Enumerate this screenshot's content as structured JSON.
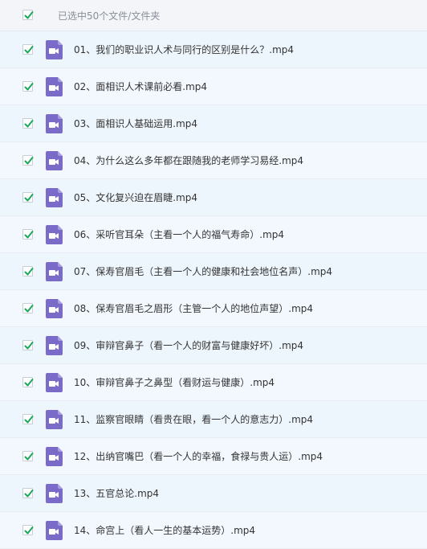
{
  "header": {
    "selection_text": "已选中50个文件/文件夹",
    "all_checked": true
  },
  "files": [
    {
      "name": "01、我们的职业识人术与同行的区别是什么？.mp4",
      "checked": true,
      "icon": "video-file-icon"
    },
    {
      "name": "02、面相识人术课前必看.mp4",
      "checked": true,
      "icon": "video-file-icon"
    },
    {
      "name": "03、面相识人基础运用.mp4",
      "checked": true,
      "icon": "video-file-icon"
    },
    {
      "name": "04、为什么这么多年都在跟随我的老师学习易经.mp4",
      "checked": true,
      "icon": "video-file-icon"
    },
    {
      "name": "05、文化复兴迫在眉睫.mp4",
      "checked": true,
      "icon": "video-file-icon"
    },
    {
      "name": "06、采听官耳朵（主看一个人的福气寿命）.mp4",
      "checked": true,
      "icon": "video-file-icon"
    },
    {
      "name": "07、保寿官眉毛（主看一个人的健康和社会地位名声）.mp4",
      "checked": true,
      "icon": "video-file-icon"
    },
    {
      "name": "08、保寿官眉毛之眉形（主管一个人的地位声望）.mp4",
      "checked": true,
      "icon": "video-file-icon"
    },
    {
      "name": "09、审辩官鼻子（看一个人的财富与健康好坏）.mp4",
      "checked": true,
      "icon": "video-file-icon"
    },
    {
      "name": "10、审辩官鼻子之鼻型（看财运与健康）.mp4",
      "checked": true,
      "icon": "video-file-icon"
    },
    {
      "name": "11、监察官眼睛（看贵在眼，看一个人的意志力）.mp4",
      "checked": true,
      "icon": "video-file-icon"
    },
    {
      "name": "12、出纳官嘴巴（看一个人的幸福，食禄与贵人运）.mp4",
      "checked": true,
      "icon": "video-file-icon"
    },
    {
      "name": "13、五官总论.mp4",
      "checked": true,
      "icon": "video-file-icon"
    },
    {
      "name": "14、命宫上（看人一生的基本运势）.mp4",
      "checked": true,
      "icon": "video-file-icon"
    }
  ],
  "colors": {
    "check": "#1aa85a",
    "video_icon": "#7b6bc9",
    "row_bg": "#eef6fd",
    "header_bg": "#f3f5f8"
  }
}
